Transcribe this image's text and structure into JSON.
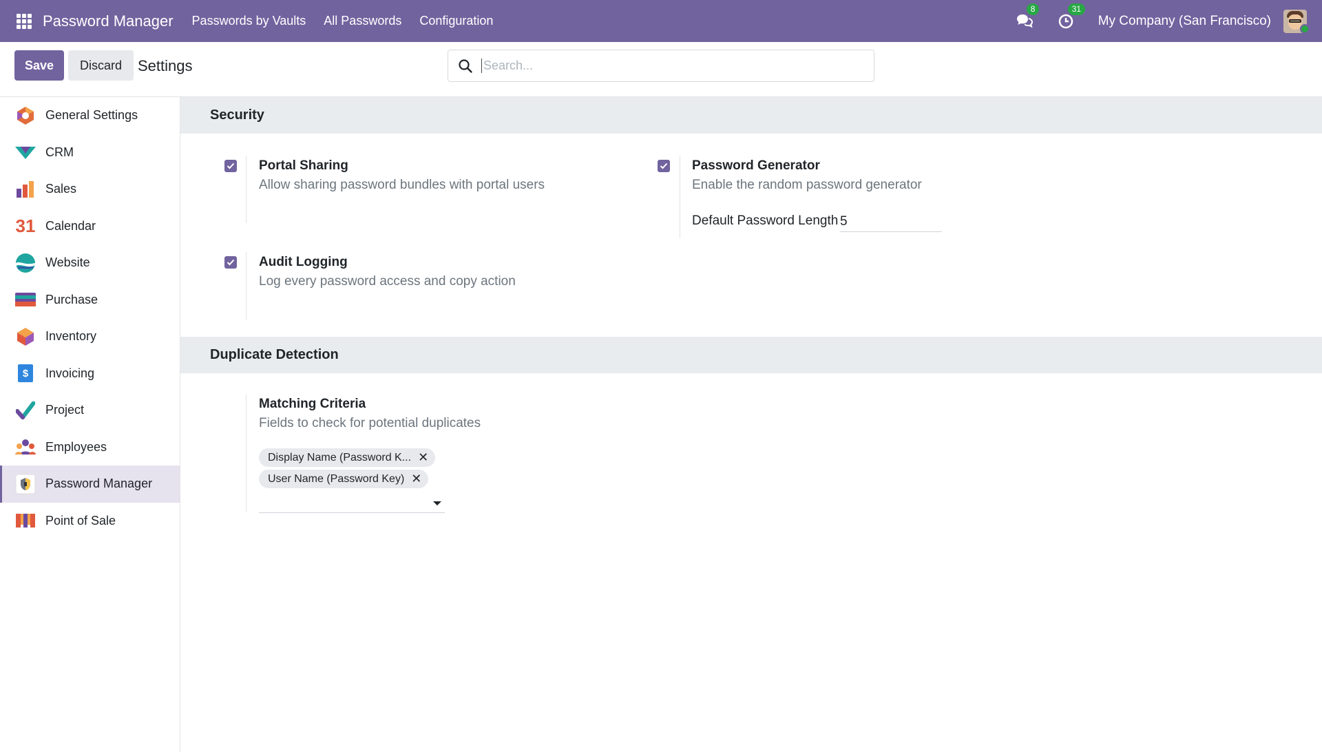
{
  "navbar": {
    "brand": "Password Manager",
    "menu": [
      "Passwords by Vaults",
      "All Passwords",
      "Configuration"
    ],
    "messages_count": "8",
    "activities_count": "31",
    "company": "My Company (San Francisco)",
    "bg_color": "#71639e"
  },
  "control_panel": {
    "save_label": "Save",
    "discard_label": "Discard",
    "breadcrumb": "Settings",
    "search_placeholder": "Search..."
  },
  "sidebar": {
    "items": [
      {
        "label": "General Settings",
        "icon": "general-settings-icon"
      },
      {
        "label": "CRM",
        "icon": "crm-icon"
      },
      {
        "label": "Sales",
        "icon": "sales-icon"
      },
      {
        "label": "Calendar",
        "icon": "calendar-icon",
        "icon_text": "31"
      },
      {
        "label": "Website",
        "icon": "website-icon"
      },
      {
        "label": "Purchase",
        "icon": "purchase-icon"
      },
      {
        "label": "Inventory",
        "icon": "inventory-icon"
      },
      {
        "label": "Invoicing",
        "icon": "invoicing-icon",
        "icon_text": "$"
      },
      {
        "label": "Project",
        "icon": "project-icon"
      },
      {
        "label": "Employees",
        "icon": "employees-icon"
      },
      {
        "label": "Password Manager",
        "icon": "password-manager-icon",
        "active": true
      },
      {
        "label": "Point of Sale",
        "icon": "point-of-sale-icon"
      }
    ]
  },
  "security": {
    "heading": "Security",
    "portal_sharing": {
      "title": "Portal Sharing",
      "desc": "Allow sharing password bundles with portal users",
      "checked": true
    },
    "password_generator": {
      "title": "Password Generator",
      "desc": "Enable the random password generator",
      "checked": true,
      "length_label": "Default Password Length",
      "length_value": "5"
    },
    "audit_logging": {
      "title": "Audit Logging",
      "desc": "Log every password access and copy action",
      "checked": true
    }
  },
  "duplicate": {
    "heading": "Duplicate Detection",
    "matching": {
      "title": "Matching Criteria",
      "desc": "Fields to check for potential duplicates",
      "tags": [
        "Display Name (Password K...",
        "User Name (Password Key)"
      ]
    }
  }
}
